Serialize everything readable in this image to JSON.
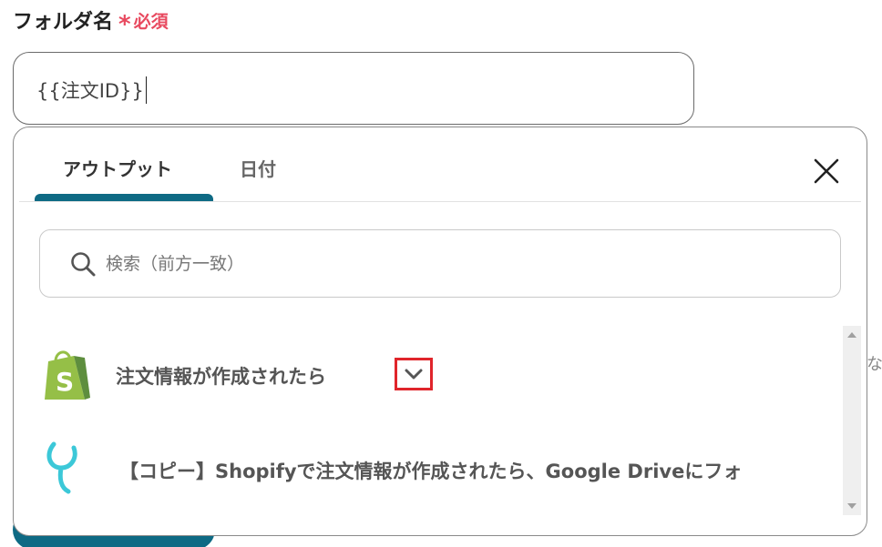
{
  "field": {
    "label": "フォルダ名",
    "required_mark": "*",
    "required_text": "必須",
    "value": "{{注文ID}}"
  },
  "popup": {
    "tabs": [
      {
        "label": "アウトプット",
        "active": true
      },
      {
        "label": "日付",
        "active": false
      }
    ],
    "close_icon": "close-icon",
    "search": {
      "placeholder": "検索（前方一致）",
      "icon": "search-icon"
    },
    "items": [
      {
        "icon": "shopify-logo",
        "title": "注文情報が作成されたら",
        "expand_icon": "chevron-down-icon"
      },
      {
        "icon": "yoom-logo",
        "title": "【コピー】Shopifyで注文情報が作成されたら、Google Driveにフォ"
      }
    ]
  },
  "background": {
    "right_peek_text": "な"
  },
  "colors": {
    "accent": "#0e6a84",
    "required": "#e8495f",
    "highlight_box": "#e0252b",
    "shopify_green": "#95bf47",
    "yoom_cyan": "#3cc8d8"
  }
}
